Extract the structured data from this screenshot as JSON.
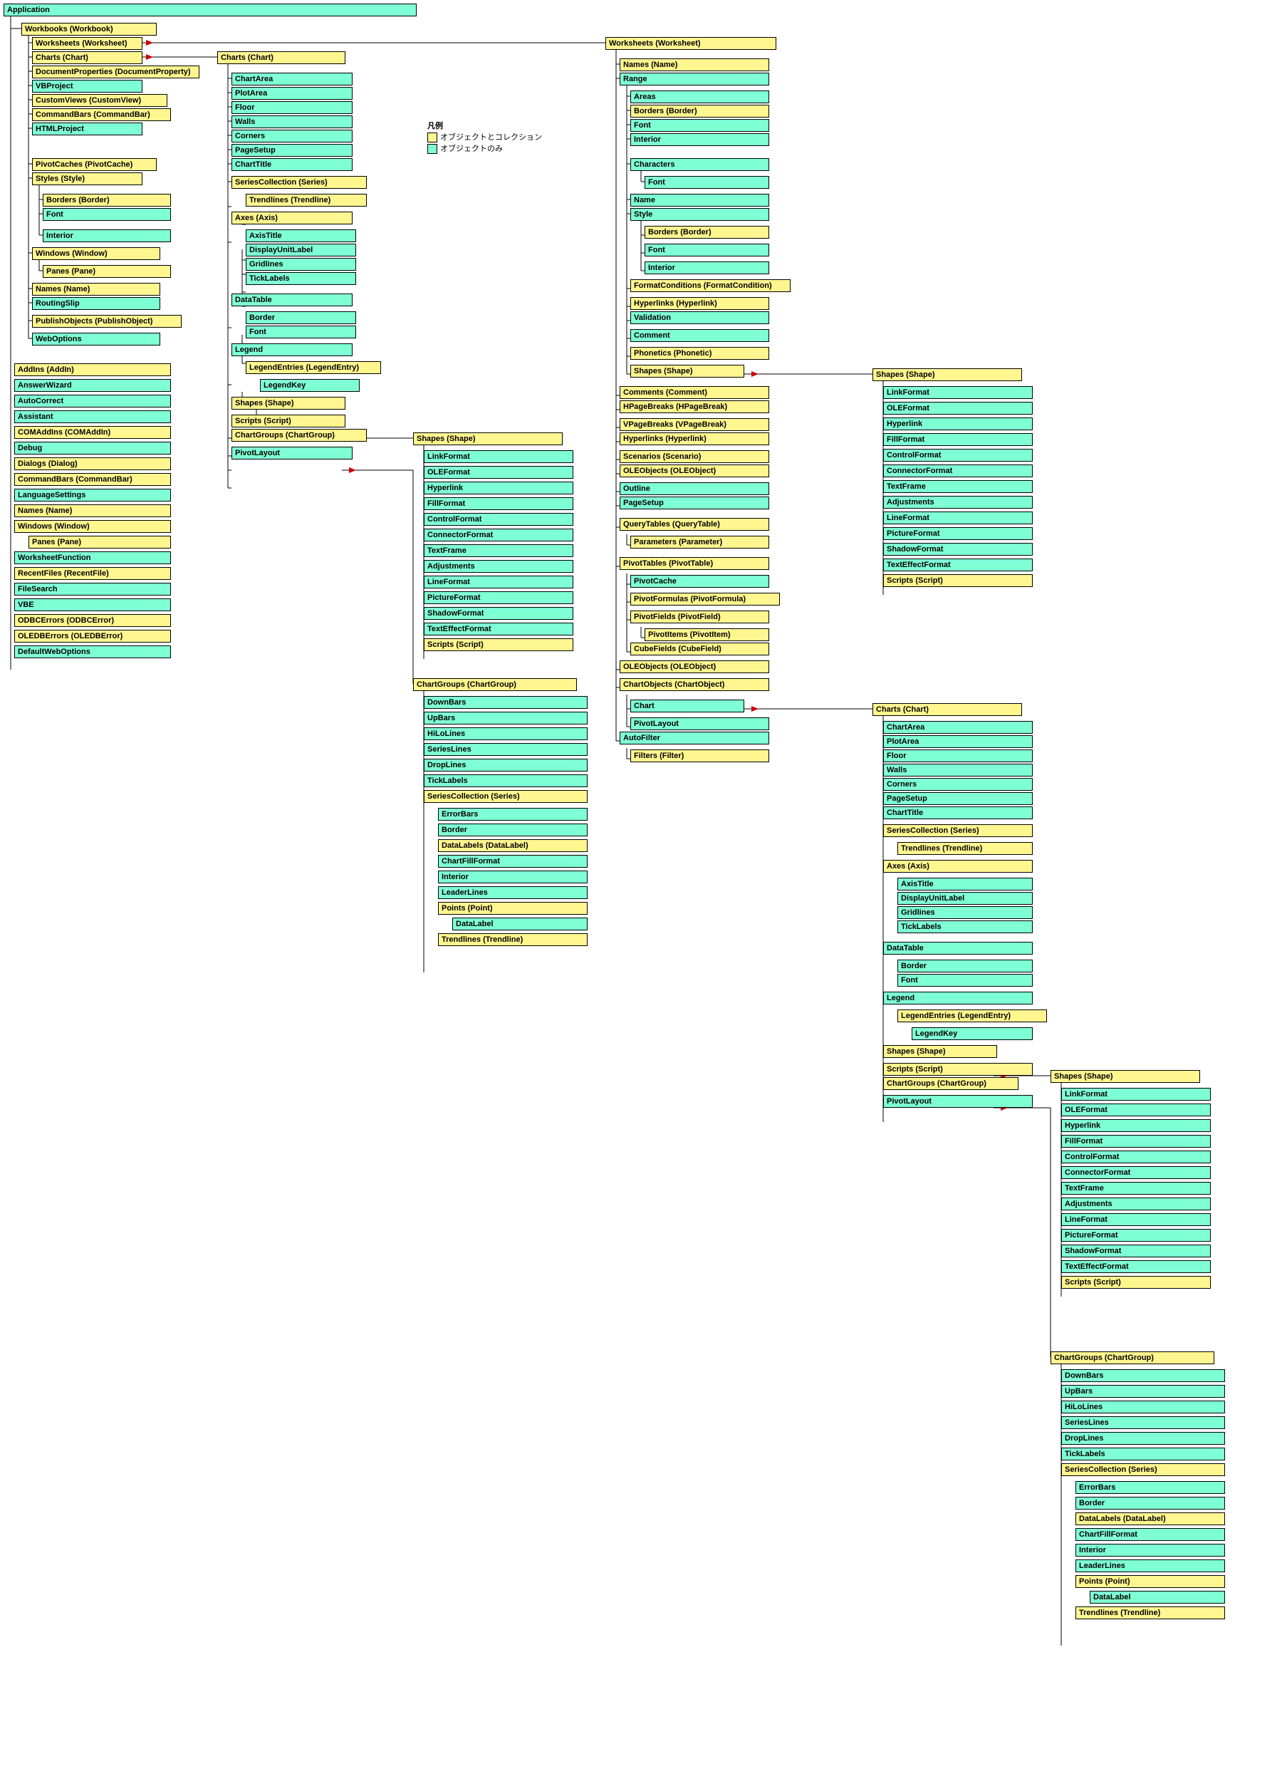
{
  "legend": {
    "title": "凡例",
    "collection": "オブジェクトとコレクション",
    "object": "オブジェクトのみ"
  },
  "app": "Application",
  "wb": "Workbooks (Workbook)",
  "c1": {
    "ws": "Worksheets (Worksheet)",
    "ch": "Charts (Chart)",
    "dp": "DocumentProperties (DocumentProperty)",
    "vbp": "VBProject",
    "cv": "CustomViews (CustomView)",
    "cb": "CommandBars (CommandBar)",
    "hp": "HTMLProject",
    "pc": "PivotCaches (PivotCache)",
    "st": "Styles (Style)",
    "bd": "Borders (Border)",
    "fn": "Font",
    "in": "Interior",
    "wn": "Windows (Window)",
    "pn": "Panes (Pane)",
    "nm": "Names (Name)",
    "rs": "RoutingSlip",
    "po": "PublishObjects (PublishObject)",
    "wo": "WebOptions"
  },
  "appc": {
    "ai": "AddIns (AddIn)",
    "aw": "AnswerWizard",
    "ac": "AutoCorrect",
    "as": "Assistant",
    "ca": "COMAddIns (COMAddIn)",
    "db": "Debug",
    "dl": "Dialogs (Dialog)",
    "cb": "CommandBars (CommandBar)",
    "ls": "LanguageSettings",
    "nm": "Names (Name)",
    "wn": "Windows (Window)",
    "pn": "Panes (Pane)",
    "wf": "WorksheetFunction",
    "rf": "RecentFiles (RecentFile)",
    "fs": "FileSearch",
    "vb": "VBE",
    "oe": "ODBCErrors (ODBCError)",
    "ole": "OLEDBErrors (OLEDBError)",
    "dwo": "DefaultWebOptions"
  },
  "chart": {
    "root": "Charts (Chart)",
    "ca": "ChartArea",
    "pa": "PlotArea",
    "fl": "Floor",
    "wl": "Walls",
    "cn": "Corners",
    "ps": "PageSetup",
    "ct": "ChartTitle",
    "sc": "SeriesCollection (Series)",
    "tl": "Trendlines (Trendline)",
    "ax": "Axes (Axis)",
    "at": "AxisTitle",
    "dul": "DisplayUnitLabel",
    "gl": "Gridlines",
    "tkl": "TickLabels",
    "dt": "DataTable",
    "bd": "Border",
    "fn": "Font",
    "lg": "Legend",
    "le": "LegendEntries (LegendEntry)",
    "lk": "LegendKey",
    "sh": "Shapes (Shape)",
    "scr": "Scripts (Script)",
    "cg": "ChartGroups (ChartGroup)",
    "pl": "PivotLayout"
  },
  "shape": {
    "root": "Shapes (Shape)",
    "lf": "LinkFormat",
    "of": "OLEFormat",
    "hl": "Hyperlink",
    "ff": "FillFormat",
    "cf": "ControlFormat",
    "cnf": "ConnectorFormat",
    "tf": "TextFrame",
    "adj": "Adjustments",
    "lnf": "LineFormat",
    "pf": "PictureFormat",
    "sf": "ShadowFormat",
    "tef": "TextEffectFormat",
    "scr": "Scripts (Script)"
  },
  "cg": {
    "root": "ChartGroups (ChartGroup)",
    "db": "DownBars",
    "ub": "UpBars",
    "hl": "HiLoLines",
    "sl": "SeriesLines",
    "dl": "DropLines",
    "tl": "TickLabels",
    "sc": "SeriesCollection (Series)",
    "eb": "ErrorBars",
    "bd": "Border",
    "dlb": "DataLabels (DataLabel)",
    "cff": "ChartFillFormat",
    "in": "Interior",
    "ll": "LeaderLines",
    "pt": "Points (Point)",
    "dla": "DataLabel",
    "tr": "Trendlines (Trendline)"
  },
  "ws": {
    "root": "Worksheets (Worksheet)",
    "nm": "Names (Name)",
    "rg": "Range",
    "ar": "Areas",
    "bd": "Borders (Border)",
    "fn": "Font",
    "in": "Interior",
    "ch": "Characters",
    "fn2": "Font",
    "nm2": "Name",
    "st": "Style",
    "bd2": "Borders (Border)",
    "fn3": "Font",
    "in2": "Interior",
    "fc": "FormatConditions (FormatCondition)",
    "hl": "Hyperlinks (Hyperlink)",
    "vl": "Validation",
    "cm": "Comment",
    "ph": "Phonetics (Phonetic)",
    "sh": "Shapes (Shape)",
    "cmt": "Comments (Comment)",
    "hpb": "HPageBreaks (HPageBreak)",
    "vpb": "VPageBreaks (VPageBreak)",
    "hl2": "Hyperlinks (Hyperlink)",
    "sc": "Scenarios (Scenario)",
    "oo": "OLEObjects (OLEObject)",
    "ol": "Outline",
    "ps": "PageSetup",
    "qt": "QueryTables (QueryTable)",
    "pm": "Parameters (Parameter)",
    "pt": "PivotTables (PivotTable)",
    "ptc": "PivotCache",
    "ptf": "PivotFormulas (PivotFormula)",
    "pfd": "PivotFields (PivotField)",
    "pit": "PivotItems (PivotItem)",
    "cf": "CubeFields (CubeField)",
    "oo2": "OLEObjects (OLEObject)",
    "co": "ChartObjects (ChartObject)",
    "crt": "Chart",
    "pl": "PivotLayout",
    "af": "AutoFilter",
    "ft": "Filters (Filter)"
  }
}
